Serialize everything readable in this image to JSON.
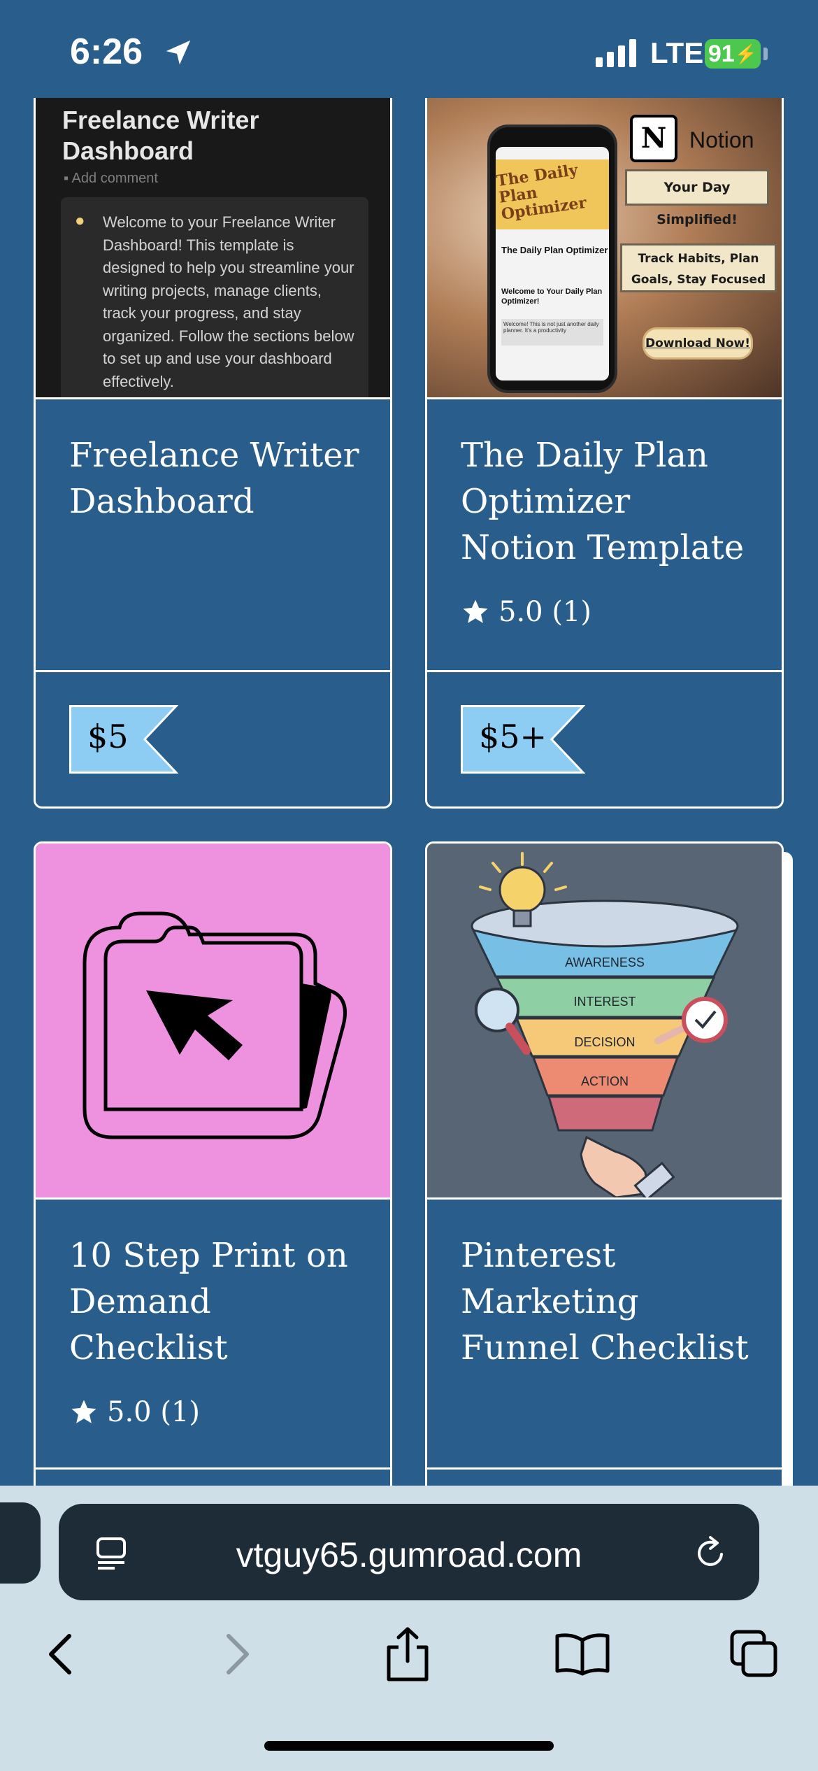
{
  "status_bar": {
    "time": "6:26",
    "network": "LTE",
    "battery": "91"
  },
  "products": [
    {
      "title": "Freelance Writer Dashboard",
      "price": "$5",
      "thumbnail": {
        "heading": "Freelance Writer Dashboard",
        "comment": "Add comment",
        "body": "Welcome to your Freelance Writer Dashboard! This template is designed to help you streamline your writing projects, manage clients, track your progress, and stay organized. Follow the sections below to set up and use your dashboard effectively."
      }
    },
    {
      "title": "The Daily Plan Optimizer Notion Template",
      "rating": "5.0 (1)",
      "price": "$5+",
      "thumbnail": {
        "notion_label": "Notion",
        "tag_1": "Your Day Simplified!",
        "tag_2": "Track Habits, Plan Goals, Stay Focused",
        "tag_3": "Download Now!",
        "phone_banner": "The Daily Plan Optimizer",
        "phone_title": "The Daily Plan Optimizer",
        "phone_welcome": "Welcome to Your Daily Plan Optimizer!",
        "phone_note": "Welcome! This is not just another daily planner. It's a productivity"
      }
    },
    {
      "title": "10 Step Print on Demand Checklist",
      "rating": "5.0 (1)"
    },
    {
      "title": "Pinterest Marketing Funnel Checklist",
      "thumbnail": {
        "stages": [
          "AWARENESS",
          "INTEREST",
          "DECISION",
          "ACTION"
        ]
      }
    }
  ],
  "browser": {
    "url": "vtguy65.gumroad.com"
  },
  "colors": {
    "page_bg": "#285d8c",
    "price_tag": "#8ecdf3",
    "pink_thumb": "#ee92e0",
    "chrome_bg": "#cfdfe8"
  }
}
